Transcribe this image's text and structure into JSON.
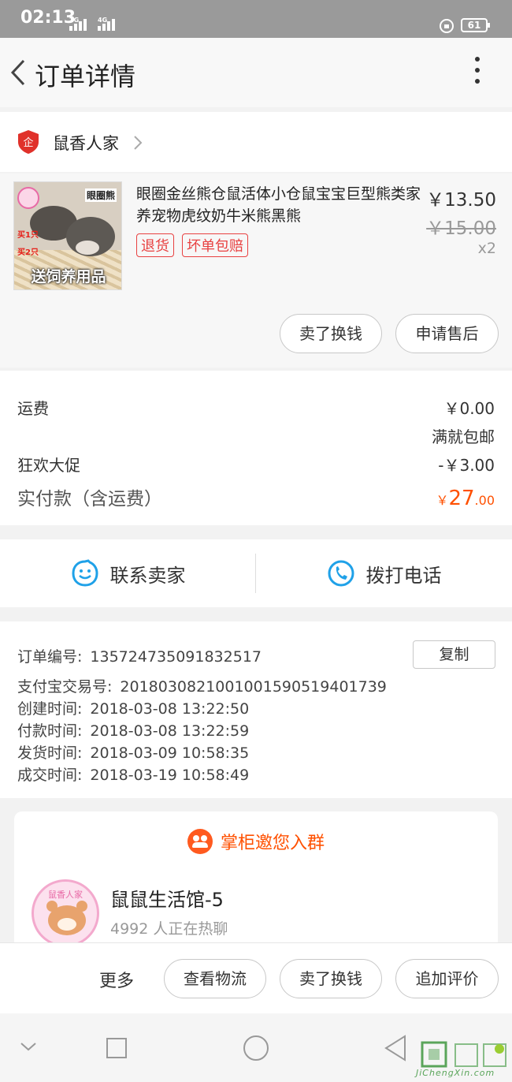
{
  "status_bar": {
    "time": "02:13",
    "net1": "2G",
    "net2": "4G",
    "battery": "61"
  },
  "nav": {
    "title": "订单详情"
  },
  "shop": {
    "name": "鼠香人家"
  },
  "item": {
    "title": "眼圈金丝熊仓鼠活体小仓鼠宝宝巨型熊类家养宠物虎纹奶牛米熊黑熊",
    "price": "￥13.50",
    "original_price": "￥15.00",
    "quantity": "x2",
    "tags": [
      "退货",
      "坏单包赔"
    ],
    "thumb_tag": "眼圈熊",
    "thumb_line1": "买1只",
    "thumb_line2": "买2只",
    "thumb_bottom": "送饲养用品",
    "buttons": [
      "卖了换钱",
      "申请售后"
    ]
  },
  "fees": {
    "shipping_label": "运费",
    "shipping_value": "￥0.00",
    "shipping_note": "满就包邮",
    "promo_label": "狂欢大促",
    "promo_value": "-￥3.00",
    "paid_label": "实付款（含运费）",
    "paid_currency": "￥",
    "paid_int": "27",
    "paid_dec": ".00"
  },
  "contact": {
    "seller": "联系卖家",
    "call": "拨打电话"
  },
  "order_info": {
    "order_no_label": "订单编号:",
    "order_no": "135724735091832517",
    "copy": "复制",
    "alipay_label": "支付宝交易号:",
    "alipay_no": "2018030821001001590519401739",
    "created_label": "创建时间:",
    "created": "2018-03-08 13:22:50",
    "paid_label": "付款时间:",
    "paid": "2018-03-08 13:22:59",
    "shipped_label": "发货时间:",
    "shipped": "2018-03-09 10:58:35",
    "closed_label": "成交时间:",
    "closed": "2018-03-19 10:58:49"
  },
  "group": {
    "header": "掌柜邀您入群",
    "name": "鼠鼠生活馆-5",
    "count": "4992 人正在热聊",
    "avatar_text": "鼠香人家"
  },
  "actions": {
    "more": "更多",
    "logistics": "查看物流",
    "sell": "卖了换钱",
    "review": "追加评价"
  },
  "watermark": {
    "text": "JiChengXin.com"
  },
  "colors": {
    "accent": "#ff5000",
    "tag_red": "#e84141",
    "icon_blue": "#1fa1e8"
  }
}
